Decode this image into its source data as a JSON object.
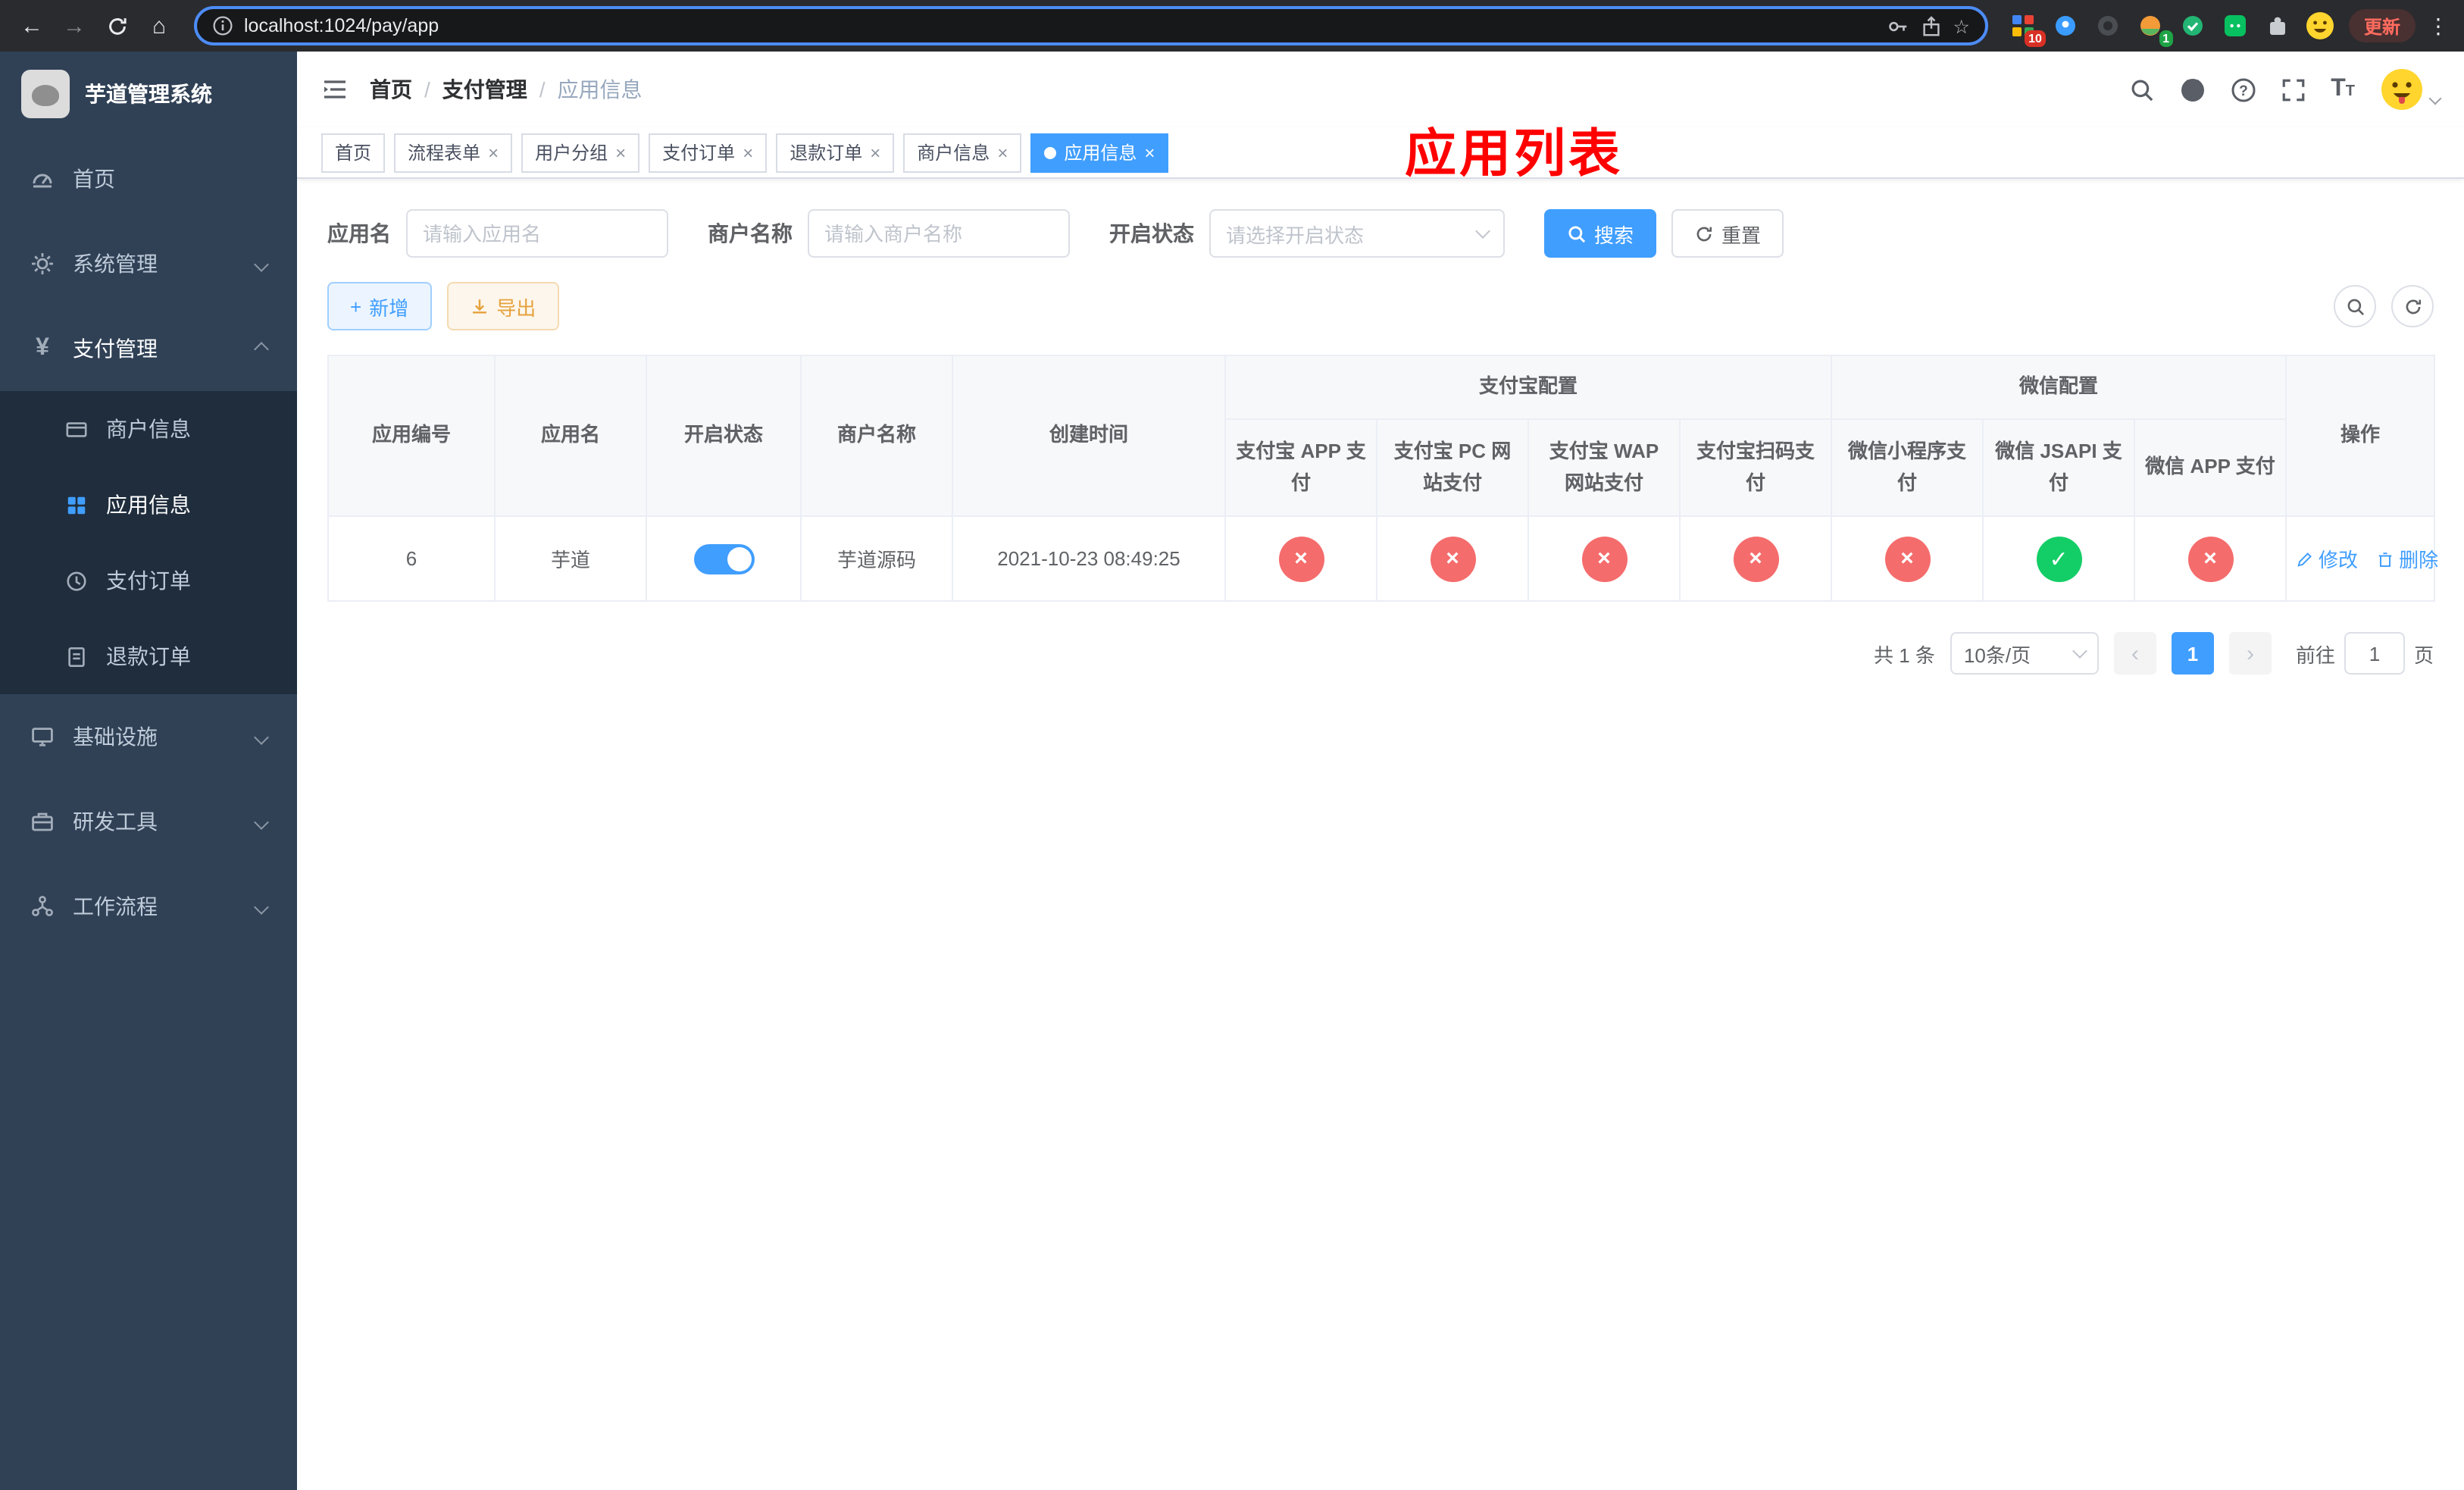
{
  "browser": {
    "url": "localhost:1024/pay/app",
    "update_label": "更新",
    "ext_badge_grid": "10",
    "ext_badge_avatar": "1"
  },
  "sidebar": {
    "app_title": "芋道管理系统",
    "menu": [
      {
        "label": "首页"
      },
      {
        "label": "系统管理"
      },
      {
        "label": "支付管理"
      },
      {
        "label": "基础设施"
      },
      {
        "label": "研发工具"
      },
      {
        "label": "工作流程"
      }
    ],
    "submenu": [
      {
        "label": "商户信息"
      },
      {
        "label": "应用信息"
      },
      {
        "label": "支付订单"
      },
      {
        "label": "退款订单"
      }
    ]
  },
  "header": {
    "breadcrumb": [
      {
        "label": "首页"
      },
      {
        "label": "支付管理"
      },
      {
        "label": "应用信息"
      }
    ],
    "overlay_title": "应用列表"
  },
  "tabs": [
    {
      "label": "首页"
    },
    {
      "label": "流程表单"
    },
    {
      "label": "用户分组"
    },
    {
      "label": "支付订单"
    },
    {
      "label": "退款订单"
    },
    {
      "label": "商户信息"
    },
    {
      "label": "应用信息"
    }
  ],
  "filters": {
    "app_name_label": "应用名",
    "app_name_placeholder": "请输入应用名",
    "merchant_label": "商户名称",
    "merchant_placeholder": "请输入商户名称",
    "status_label": "开启状态",
    "status_placeholder": "请选择开启状态",
    "search_label": "搜索",
    "reset_label": "重置"
  },
  "toolbar": {
    "add_label": "新增",
    "export_label": "导出"
  },
  "table": {
    "headers": {
      "app_id": "应用编号",
      "app_name": "应用名",
      "status": "开启状态",
      "merchant": "商户名称",
      "created": "创建时间",
      "alipay_group": "支付宝配置",
      "wechat_group": "微信配置",
      "alipay_app": "支付宝 APP 支付",
      "alipay_pc": "支付宝 PC 网站支付",
      "alipay_wap": "支付宝 WAP 网站支付",
      "alipay_qr": "支付宝扫码支付",
      "wx_mini": "微信小程序支付",
      "wx_jsapi": "微信 JSAPI 支付",
      "wx_app": "微信 APP 支付",
      "actions": "操作"
    },
    "rows": [
      {
        "app_id": "6",
        "app_name": "芋道",
        "enabled": true,
        "merchant": "芋道源码",
        "created": "2021-10-23 08:49:25",
        "channels": [
          false,
          false,
          false,
          false,
          false,
          true,
          false
        ],
        "edit_label": "修改",
        "delete_label": "删除"
      }
    ]
  },
  "pagination": {
    "total_text": "共 1 条",
    "page_size": "10条/页",
    "current_page": "1",
    "goto_label": "前往",
    "goto_value": "1",
    "goto_suffix": "页"
  }
}
